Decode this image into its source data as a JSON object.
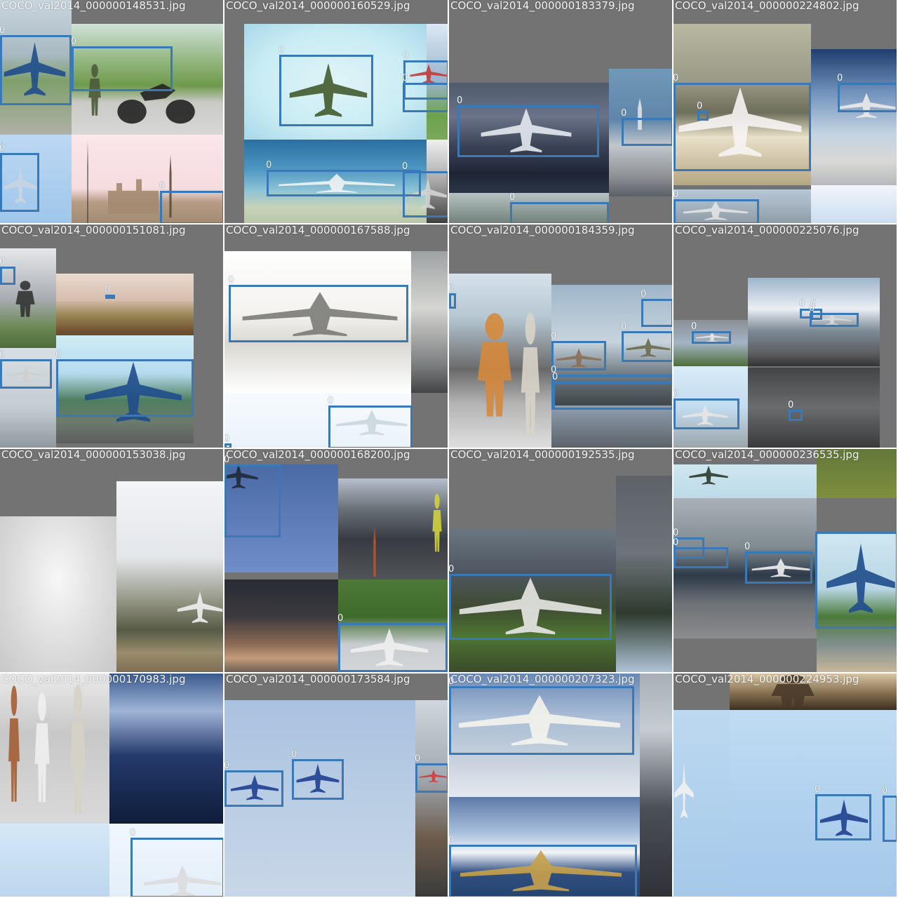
{
  "title": "",
  "colors": {
    "box": "#3a79b8",
    "label": "#ffffff",
    "padding": "#737373",
    "grid_line": "#ffffff"
  },
  "icons": [
    "airplane-icon",
    "person-icon",
    "motorcycle-icon",
    "building-icon",
    "tower-icon"
  ],
  "tiles": [
    {
      "filename": "COCO_val2014_000000148531.jpg",
      "class_labels": [
        "0",
        "0",
        "0",
        "0"
      ]
    },
    {
      "filename": "COCO_val2014_000000160529.jpg",
      "class_labels": [
        "0",
        "0",
        "0",
        "0",
        "0"
      ]
    },
    {
      "filename": "COCO_val2014_000000183379.jpg",
      "class_labels": [
        "0",
        "0",
        "0"
      ]
    },
    {
      "filename": "COCO_val2014_000000224802.jpg",
      "class_labels": [
        "0",
        "0",
        "0",
        "0"
      ]
    },
    {
      "filename": "COCO_val2014_000000151081.jpg",
      "class_labels": [
        "0",
        "0",
        "0",
        "0"
      ]
    },
    {
      "filename": "COCO_val2014_000000167588.jpg",
      "class_labels": [
        "0",
        "0",
        "0"
      ]
    },
    {
      "filename": "COCO_val2014_000000184359.jpg",
      "class_labels": [
        "0",
        "0",
        "0",
        "0",
        "0",
        "0"
      ]
    },
    {
      "filename": "COCO_val2014_000000225076.jpg",
      "class_labels": [
        "0",
        "0",
        "0",
        "0",
        "0",
        "0"
      ]
    },
    {
      "filename": "COCO_val2014_000000153038.jpg",
      "class_labels": []
    },
    {
      "filename": "COCO_val2014_000000168200.jpg",
      "class_labels": [
        "0",
        "0"
      ]
    },
    {
      "filename": "COCO_val2014_000000192535.jpg",
      "class_labels": [
        "0"
      ]
    },
    {
      "filename": "COCO_val2014_000000236535.jpg",
      "class_labels": [
        "0",
        "0",
        "0"
      ]
    },
    {
      "filename": "COCO_val2014_000000170983.jpg",
      "class_labels": [
        "0"
      ]
    },
    {
      "filename": "COCO_val2014_000000173584.jpg",
      "class_labels": [
        "0",
        "0",
        "0"
      ]
    },
    {
      "filename": "COCO_val2014_000000207323.jpg",
      "class_labels": [
        "0",
        "0"
      ]
    },
    {
      "filename": "COCO_val2014_000000224953.jpg",
      "class_labels": [
        "0",
        "0"
      ]
    }
  ]
}
